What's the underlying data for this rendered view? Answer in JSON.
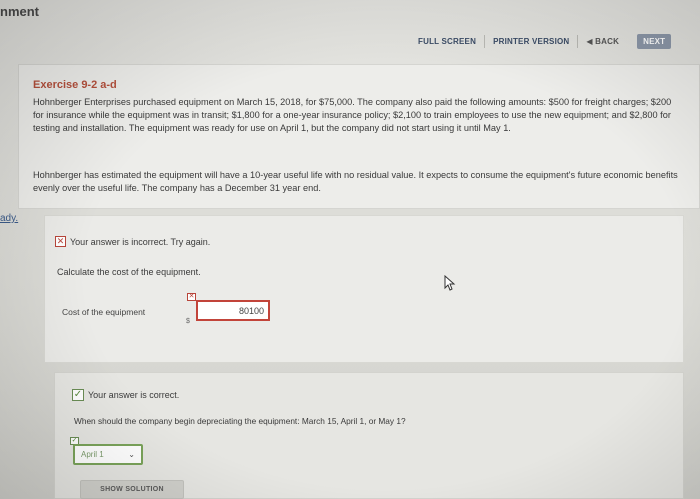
{
  "window": {
    "title_fragment": "nment"
  },
  "toolbar": {
    "full_screen": "FULL SCREEN",
    "printer_version": "PRINTER VERSION",
    "back": "◀ BACK",
    "next": "NEXT"
  },
  "exercise": {
    "title": "Exercise 9-2 a-d",
    "paragraph1": "Hohnberger Enterprises purchased equipment on March 15, 2018, for $75,000. The company also paid the following amounts: $500 for freight charges; $200 for insurance while the equipment was in transit; $1,800 for a one-year insurance policy; $2,100 to train employees to use the new equipment; and $2,800 for testing and installation. The equipment was ready for use on April 1, but the company did not start using it until May 1.",
    "paragraph2": "Hohnberger has estimated the equipment will have a 10-year useful life with no residual value. It expects to consume the equipment's future economic benefits evenly over the useful life. The company has a December 31 year end."
  },
  "side_link": "ady.",
  "part_a": {
    "status": "Your answer is incorrect.  Try again.",
    "question": "Calculate the cost of the equipment.",
    "field_label": "Cost of the equipment",
    "currency": "$",
    "value": "80100",
    "status_color": "#b8453a"
  },
  "part_b": {
    "status": "Your answer is correct.",
    "question": "When should the company begin depreciating the equipment: March 15, April 1, or May 1?",
    "selected": "April 1",
    "solution_button": "SHOW SOLUTION",
    "status_color": "#5a8a3e"
  }
}
